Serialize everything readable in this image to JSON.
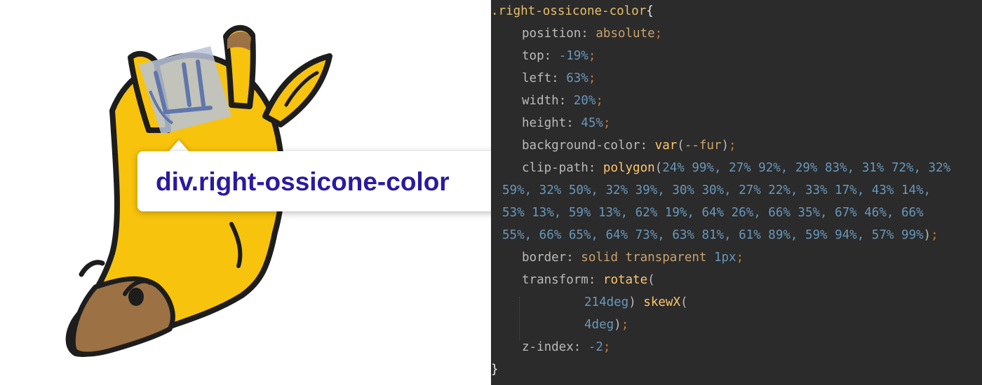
{
  "preview": {
    "element_tooltip": {
      "tag": "div",
      "class_name": ".right-ossicone-color"
    },
    "colors": {
      "fur": "#f8c30c",
      "outline": "#1d1d1d",
      "muzzle": "#9c7144",
      "highlight": "#b9c3d9"
    }
  },
  "editor": {
    "selector": ".right-ossicone-color",
    "open_brace": "{",
    "close_brace": "}",
    "declarations": {
      "position": {
        "prop": "position",
        "value": "absolute"
      },
      "top": {
        "prop": "top",
        "value": "-19%"
      },
      "left": {
        "prop": "left",
        "value": "63%"
      },
      "width": {
        "prop": "width",
        "value": "20%"
      },
      "height": {
        "prop": "height",
        "value": "45%"
      },
      "background": {
        "prop": "background-color",
        "fn": "var",
        "arg": "--fur"
      },
      "clip_path": {
        "prop": "clip-path",
        "fn": "polygon",
        "lines": [
          "24% 99%, 27% 92%, 29% 83%, 31% 72%, 32%",
          "59%, 32% 50%, 32% 39%, 30% 30%, 27% 22%, 33% 17%, 43% 14%,",
          "53% 13%, 59% 13%, 62% 19%, 64% 26%, 66% 35%, 67% 46%, 66%",
          "55%, 66% 65%, 64% 73%, 63% 81%, 61% 89%, 59% 94%, 57% 99%"
        ]
      },
      "border": {
        "prop": "border",
        "values": [
          "solid",
          "transparent",
          "1px"
        ]
      },
      "transform": {
        "prop": "transform",
        "fn1": "rotate",
        "arg1": "214deg",
        "fn2": "skewX",
        "arg2": "4deg"
      },
      "z_index": {
        "prop": "z-index",
        "value": "-2"
      }
    }
  }
}
